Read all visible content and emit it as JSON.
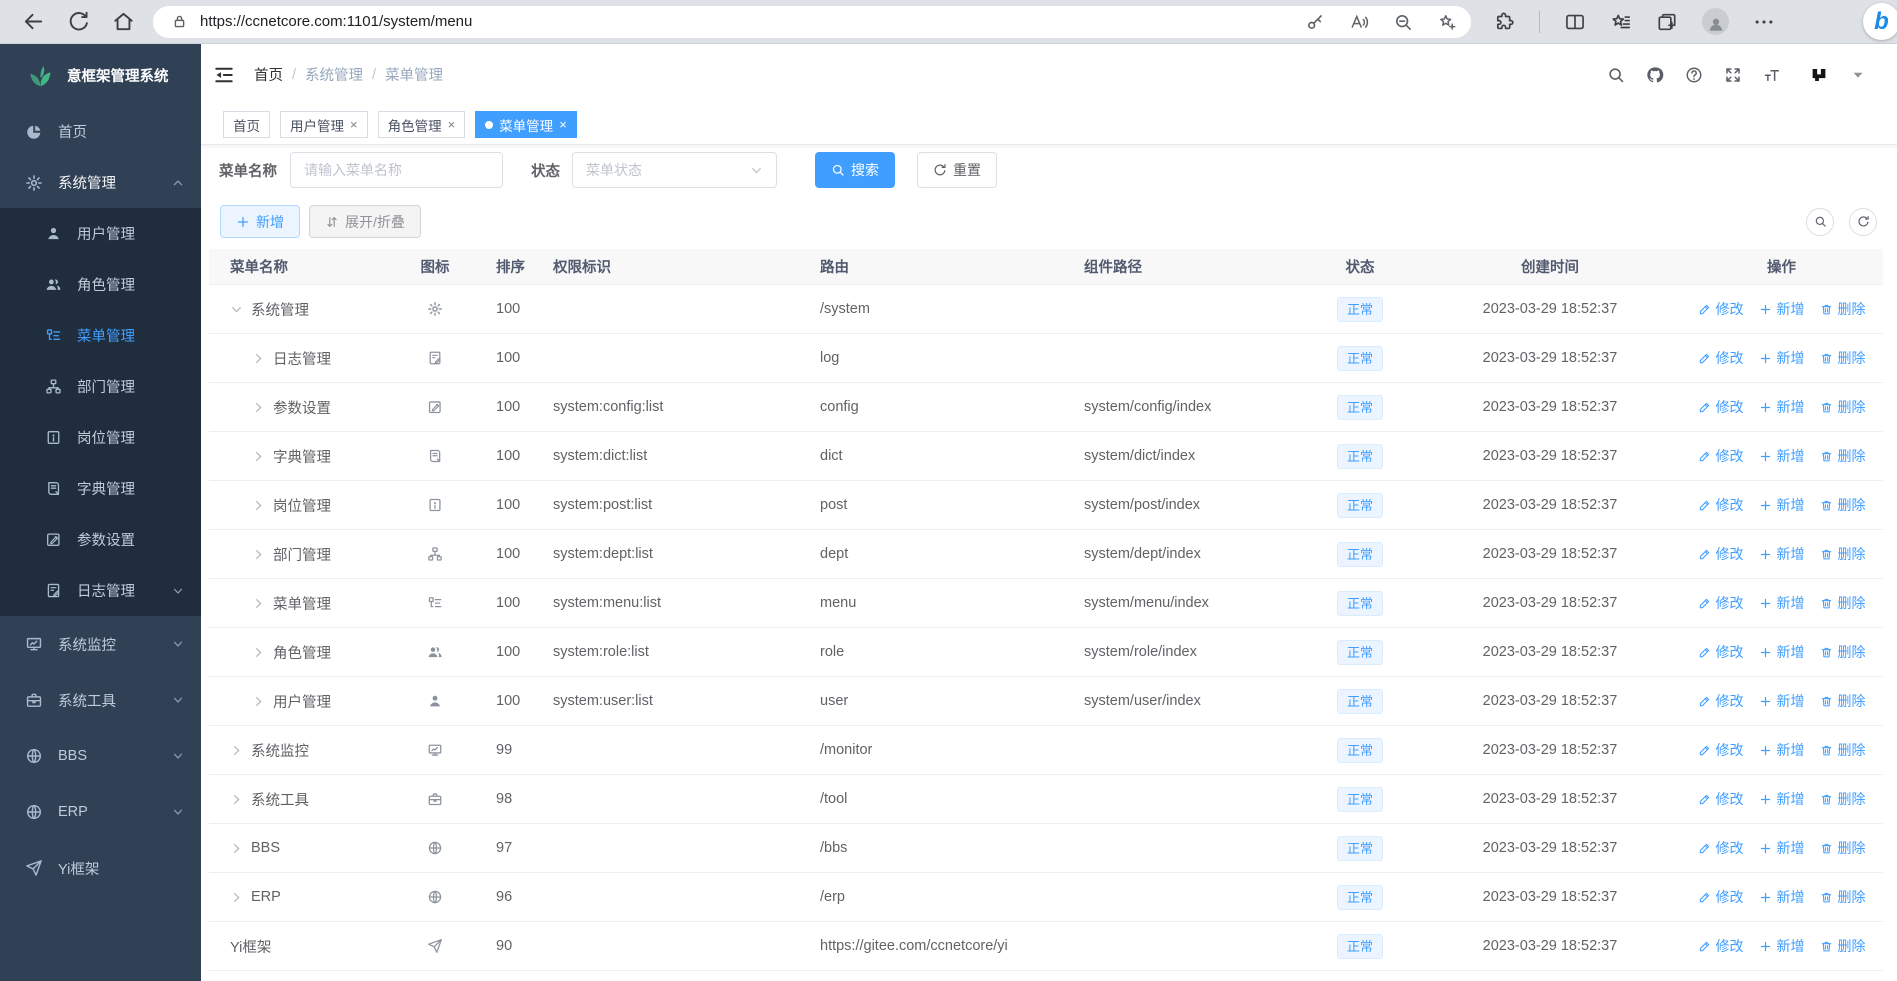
{
  "browser": {
    "url": "https://ccnetcore.com:1101/system/menu",
    "left_icons": [
      "back",
      "reload",
      "home"
    ],
    "url_icon": "lock",
    "pill_right_icons": [
      "key",
      "read-aloud",
      "zoom-out",
      "favorite-add"
    ],
    "right_icons": [
      "extensions",
      "split-screen",
      "favorites",
      "collections",
      "profile",
      "more"
    ],
    "assistant_icon": "copilot",
    "assistant_glyph": "b"
  },
  "app": {
    "logo_icon": "leaf",
    "title": "意框架管理系统"
  },
  "sidebar": {
    "items": [
      {
        "label": "首页",
        "icon": "dashboard"
      },
      {
        "label": "系统管理",
        "icon": "gear",
        "expanded": true,
        "children": [
          {
            "label": "用户管理",
            "icon": "user"
          },
          {
            "label": "角色管理",
            "icon": "users"
          },
          {
            "label": "菜单管理",
            "icon": "menu",
            "active": true
          },
          {
            "label": "部门管理",
            "icon": "tree"
          },
          {
            "label": "岗位管理",
            "icon": "post"
          },
          {
            "label": "字典管理",
            "icon": "dict"
          },
          {
            "label": "参数设置",
            "icon": "edit"
          },
          {
            "label": "日志管理",
            "icon": "log",
            "arrow": "down"
          }
        ]
      },
      {
        "label": "系统监控",
        "icon": "monitor",
        "arrow": "down"
      },
      {
        "label": "系统工具",
        "icon": "tool",
        "arrow": "down"
      },
      {
        "label": "BBS",
        "icon": "globe",
        "arrow": "down"
      },
      {
        "label": "ERP",
        "icon": "globe",
        "arrow": "down"
      },
      {
        "label": "Yi框架",
        "icon": "plane"
      }
    ]
  },
  "header": {
    "breadcrumb": [
      "首页",
      "系统管理",
      "菜单管理"
    ],
    "action_icons": [
      "search",
      "github",
      "question",
      "fullscreen",
      "font-size"
    ],
    "avatar_icon": "yi-logo",
    "caret_icon": "caret-down"
  },
  "tabs": [
    {
      "label": "首页",
      "closable": false,
      "active": false
    },
    {
      "label": "用户管理",
      "closable": true,
      "active": false
    },
    {
      "label": "角色管理",
      "closable": true,
      "active": false
    },
    {
      "label": "菜单管理",
      "closable": true,
      "active": true
    }
  ],
  "filters": {
    "name_label": "菜单名称",
    "name_placeholder": "请输入菜单名称",
    "name_value": "",
    "status_label": "状态",
    "status_placeholder": "菜单状态",
    "search_label": "搜索",
    "reset_label": "重置"
  },
  "toolbar": {
    "add_label": "新增",
    "fold_label": "展开/折叠",
    "right_icons": [
      "search",
      "refresh"
    ]
  },
  "table": {
    "columns": [
      "菜单名称",
      "图标",
      "排序",
      "权限标识",
      "路由",
      "组件路径",
      "状态",
      "创建时间",
      "操作"
    ],
    "row_actions": [
      {
        "label": "修改",
        "icon": "pen",
        "key": "edit"
      },
      {
        "label": "新增",
        "icon": "plus",
        "key": "add"
      },
      {
        "label": "删除",
        "icon": "trash",
        "key": "delete"
      }
    ],
    "rows": [
      {
        "name": "系统管理",
        "icon": "gear",
        "sort": "100",
        "perm": "",
        "route": "/system",
        "comp": "",
        "status": "正常",
        "created": "2023-03-29 18:52:37",
        "level": 0,
        "arrow": "down"
      },
      {
        "name": "日志管理",
        "icon": "log",
        "sort": "100",
        "perm": "",
        "route": "log",
        "comp": "",
        "status": "正常",
        "created": "2023-03-29 18:52:37",
        "level": 1,
        "arrow": "right"
      },
      {
        "name": "参数设置",
        "icon": "edit",
        "sort": "100",
        "perm": "system:config:list",
        "route": "config",
        "comp": "system/config/index",
        "status": "正常",
        "created": "2023-03-29 18:52:37",
        "level": 1,
        "arrow": "right"
      },
      {
        "name": "字典管理",
        "icon": "dict",
        "sort": "100",
        "perm": "system:dict:list",
        "route": "dict",
        "comp": "system/dict/index",
        "status": "正常",
        "created": "2023-03-29 18:52:37",
        "level": 1,
        "arrow": "right"
      },
      {
        "name": "岗位管理",
        "icon": "post",
        "sort": "100",
        "perm": "system:post:list",
        "route": "post",
        "comp": "system/post/index",
        "status": "正常",
        "created": "2023-03-29 18:52:37",
        "level": 1,
        "arrow": "right"
      },
      {
        "name": "部门管理",
        "icon": "tree",
        "sort": "100",
        "perm": "system:dept:list",
        "route": "dept",
        "comp": "system/dept/index",
        "status": "正常",
        "created": "2023-03-29 18:52:37",
        "level": 1,
        "arrow": "right"
      },
      {
        "name": "菜单管理",
        "icon": "menu",
        "sort": "100",
        "perm": "system:menu:list",
        "route": "menu",
        "comp": "system/menu/index",
        "status": "正常",
        "created": "2023-03-29 18:52:37",
        "level": 1,
        "arrow": "right"
      },
      {
        "name": "角色管理",
        "icon": "users",
        "sort": "100",
        "perm": "system:role:list",
        "route": "role",
        "comp": "system/role/index",
        "status": "正常",
        "created": "2023-03-29 18:52:37",
        "level": 1,
        "arrow": "right"
      },
      {
        "name": "用户管理",
        "icon": "user",
        "sort": "100",
        "perm": "system:user:list",
        "route": "user",
        "comp": "system/user/index",
        "status": "正常",
        "created": "2023-03-29 18:52:37",
        "level": 1,
        "arrow": "right"
      },
      {
        "name": "系统监控",
        "icon": "monitor",
        "sort": "99",
        "perm": "",
        "route": "/monitor",
        "comp": "",
        "status": "正常",
        "created": "2023-03-29 18:52:37",
        "level": 0,
        "arrow": "right"
      },
      {
        "name": "系统工具",
        "icon": "tool",
        "sort": "98",
        "perm": "",
        "route": "/tool",
        "comp": "",
        "status": "正常",
        "created": "2023-03-29 18:52:37",
        "level": 0,
        "arrow": "right"
      },
      {
        "name": "BBS",
        "icon": "globe",
        "sort": "97",
        "perm": "",
        "route": "/bbs",
        "comp": "",
        "status": "正常",
        "created": "2023-03-29 18:52:37",
        "level": 0,
        "arrow": "right"
      },
      {
        "name": "ERP",
        "icon": "globe",
        "sort": "96",
        "perm": "",
        "route": "/erp",
        "comp": "",
        "status": "正常",
        "created": "2023-03-29 18:52:37",
        "level": 0,
        "arrow": "right"
      },
      {
        "name": "Yi框架",
        "icon": "plane",
        "sort": "90",
        "perm": "",
        "route": "https://gitee.com/ccnetcore/yi",
        "comp": "",
        "status": "正常",
        "created": "2023-03-29 18:52:37",
        "level": 0,
        "arrow": "none"
      }
    ]
  },
  "colors": {
    "accent": "#409eff",
    "sidebar_bg": "#304156",
    "submenu_bg": "#1f2d3d",
    "sidebar_text": "#bfcbd9",
    "badge_bg": "#ecf5ff",
    "badge_border": "#d9ecff",
    "logo_green": "#43b884",
    "browser_bar_bg": "#dee1e6"
  }
}
